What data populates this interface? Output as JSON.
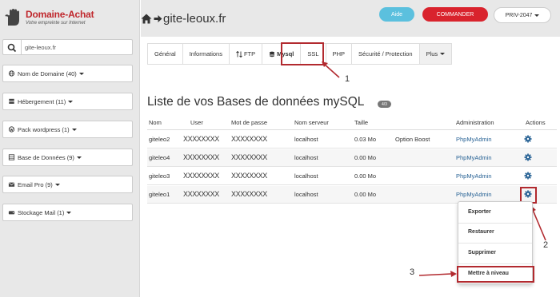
{
  "brand": {
    "name": "Domaine-Achat",
    "tagline": "Votre empreinte sur Internet",
    "color": "#c0282d"
  },
  "sidebar": {
    "search_value": "gite-leoux.fr",
    "items": [
      {
        "label": "Nom de Domaine (40)",
        "icon": "globe-icon"
      },
      {
        "label": "Hébergement (11)",
        "icon": "server-icon"
      },
      {
        "label": "Pack wordpress (1)",
        "icon": "wordpress-icon"
      },
      {
        "label": "Base de Données (9)",
        "icon": "database-icon"
      },
      {
        "label": "Email Pro (9)",
        "icon": "envelope-icon"
      },
      {
        "label": "Stockage Mail (1)",
        "icon": "drive-icon"
      }
    ]
  },
  "header": {
    "domain": "gite-leoux.fr",
    "aide_label": "Aide",
    "commander_label": "COMMANDER",
    "account_label": "PRIV-2047",
    "colors": {
      "aide": "#5bc0de",
      "commander": "#d9232d"
    }
  },
  "tabs": [
    {
      "label": "Général"
    },
    {
      "label": "Informations"
    },
    {
      "label": "FTP",
      "icon": "sort-arrows-icon"
    },
    {
      "label": "Mysql",
      "icon": "database-icon",
      "active": true
    },
    {
      "label": "SSL"
    },
    {
      "label": "PHP"
    },
    {
      "label": "Sécurité / Protection"
    },
    {
      "label": "Plus"
    }
  ],
  "annotations": {
    "n1": "1",
    "n2": "2",
    "n3": "3",
    "color": "#b22a2f"
  },
  "main": {
    "title": "Liste de vos Bases de données mySQL",
    "badge": "4/3",
    "columns": [
      "Nom",
      "User",
      "Mot de passe",
      "Nom serveur",
      "Taille",
      "Administration",
      "Actions"
    ],
    "rows": [
      {
        "name": "giteleo2",
        "user": "XXXXXXXX",
        "password": "XXXXXXXX",
        "server": "localhost",
        "size": "0.03 Mo",
        "extra": "Option Boost",
        "admin": "PhpMyAdmin"
      },
      {
        "name": "giteleo4",
        "user": "XXXXXXXX",
        "password": "XXXXXXXX",
        "server": "localhost",
        "size": "0.00 Mo",
        "extra": "",
        "admin": "PhpMyAdmin"
      },
      {
        "name": "giteleo3",
        "user": "XXXXXXXX",
        "password": "XXXXXXXX",
        "server": "localhost",
        "size": "0.00 Mo",
        "extra": "",
        "admin": "PhpMyAdmin"
      },
      {
        "name": "giteleo1",
        "user": "XXXXXXXX",
        "password": "XXXXXXXX",
        "server": "localhost",
        "size": "0.00 Mo",
        "extra": "",
        "admin": "PhpMyAdmin"
      }
    ]
  },
  "dropdown": {
    "items": [
      "Exporter",
      "Restaurer",
      "Supprimer",
      "Mettre à niveau"
    ]
  }
}
